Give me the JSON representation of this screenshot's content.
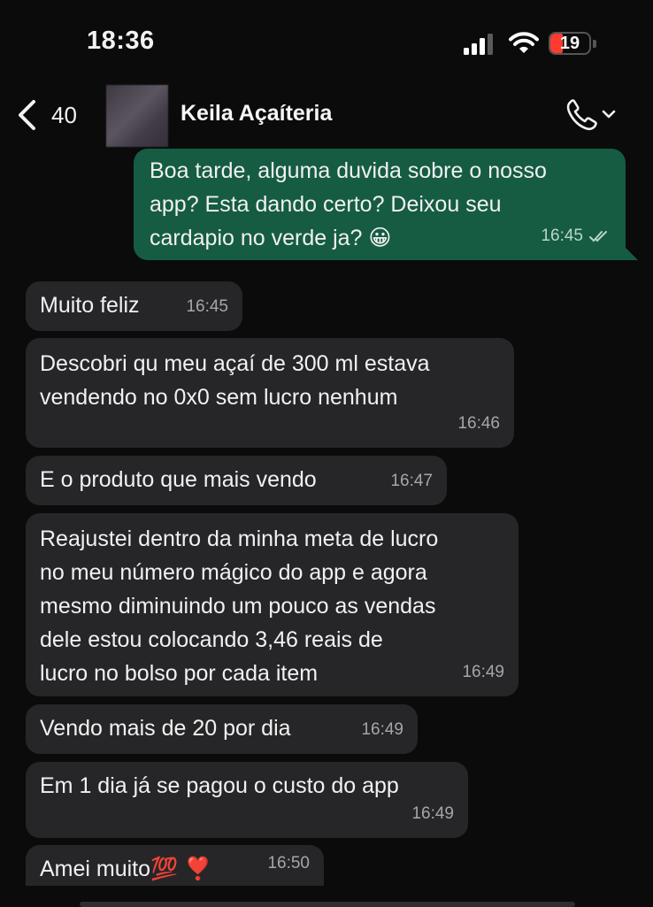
{
  "status_bar": {
    "time": "18:36",
    "battery_level": "19",
    "battery_color": "#ff3b30"
  },
  "header": {
    "back_count": "40",
    "contact_name": "Keila Açaíteria",
    "call_icon": "phone-icon",
    "dropdown_icon": "chevron-down-icon"
  },
  "messages": [
    {
      "direction": "out",
      "text": "Boa tarde, alguma duvida sobre o nosso\napp? Esta dando certo? Deixou seu\ncardapio no verde ja? 😀",
      "time": "16:45",
      "status": "read"
    },
    {
      "direction": "in",
      "text": "Muito feliz",
      "time": "16:45"
    },
    {
      "direction": "in",
      "text": "Descobri qu meu açaí de 300 ml estava\nvendendo no 0x0 sem lucro nenhum",
      "time": "16:46"
    },
    {
      "direction": "in",
      "text": "E o produto que mais vendo",
      "time": "16:47"
    },
    {
      "direction": "in",
      "text": "Reajustei dentro da minha meta de lucro\nno meu número mágico do app e agora\nmesmo diminuindo um pouco as vendas\ndele estou colocando 3,46 reais de\nlucro no bolso por cada item",
      "time": "16:49"
    },
    {
      "direction": "in",
      "text": "Vendo mais de 20 por dia",
      "time": "16:49"
    },
    {
      "direction": "in",
      "text": "Em 1 dia já se pagou o custo do app",
      "time": "16:49"
    },
    {
      "direction": "in",
      "text": "Amei muito💯 ❣️",
      "time": "16:50"
    }
  ],
  "colors": {
    "background": "#0b0b0b",
    "incoming_bubble": "#262628",
    "outgoing_bubble": "#155c43",
    "timestamp": "#a6a6a6"
  }
}
